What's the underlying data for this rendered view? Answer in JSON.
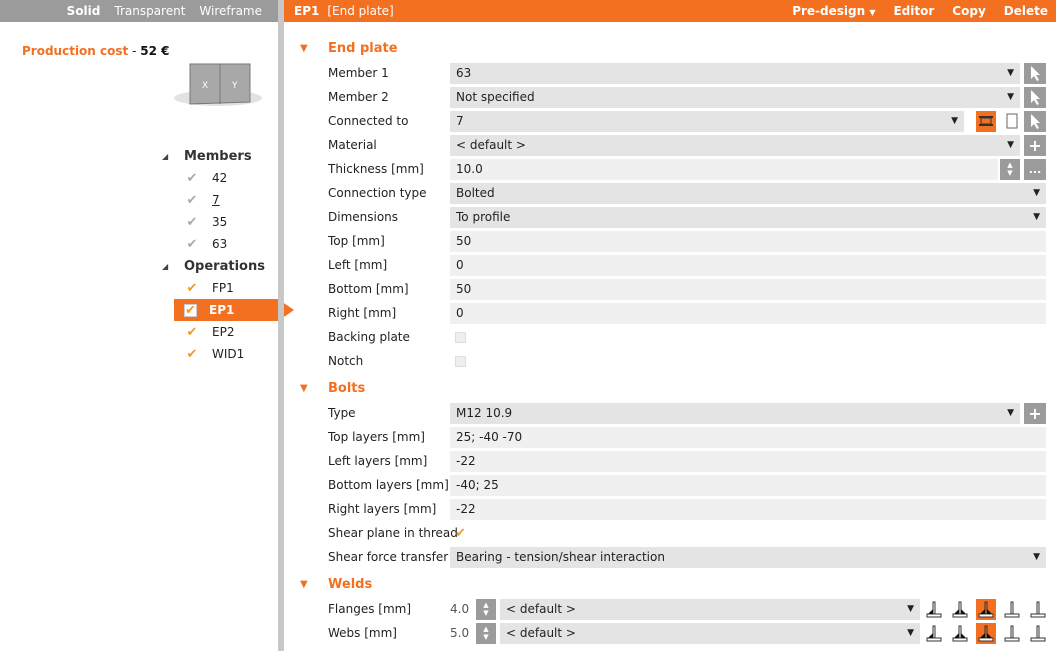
{
  "left": {
    "view_modes": [
      "Solid",
      "Transparent",
      "Wireframe"
    ],
    "active_mode": "Solid",
    "cost_label": "Production cost",
    "cost_sep": "-",
    "cost_value": "52 €",
    "members_label": "Members",
    "members": [
      "42",
      "7",
      "35",
      "63"
    ],
    "operations_label": "Operations",
    "operations": [
      "FP1",
      "EP1",
      "EP2",
      "WID1"
    ],
    "selected_operation": "EP1"
  },
  "header": {
    "id": "EP1",
    "name": "[End plate]",
    "predesign": "Pre-design",
    "editor": "Editor",
    "copy": "Copy",
    "delete": "Delete"
  },
  "sections": [
    {
      "title": "End plate",
      "rows": [
        {
          "label": "Member 1",
          "value": "63",
          "kind": "dd",
          "btn": "pick"
        },
        {
          "label": "Member 2",
          "value": "Not specified",
          "kind": "dd",
          "btn": "pick"
        },
        {
          "label": "Connected to",
          "value": "7",
          "kind": "dd-short",
          "btn": "pick"
        },
        {
          "label": "Material",
          "value": "< default >",
          "kind": "dd",
          "btn": "plus"
        },
        {
          "label": "Thickness [mm]",
          "value": "10.0",
          "kind": "tx-spin",
          "btn": "more",
          "more": "..."
        },
        {
          "label": "Connection type",
          "value": "Bolted",
          "kind": "ddfull"
        },
        {
          "label": "Dimensions",
          "value": "To profile",
          "kind": "ddfull"
        },
        {
          "label": "Top [mm]",
          "value": "50",
          "kind": "tx"
        },
        {
          "label": "Left [mm]",
          "value": "0",
          "kind": "tx"
        },
        {
          "label": "Bottom [mm]",
          "value": "50",
          "kind": "tx"
        },
        {
          "label": "Right [mm]",
          "value": "0",
          "kind": "tx"
        },
        {
          "label": "Backing plate",
          "kind": "cb",
          "checked": false
        },
        {
          "label": "Notch",
          "kind": "cb",
          "checked": false
        }
      ]
    },
    {
      "title": "Bolts",
      "rows": [
        {
          "label": "Type",
          "value": "M12 10.9",
          "kind": "dd",
          "btn": "plus"
        },
        {
          "label": "Top layers [mm]",
          "value": "25; -40 -70",
          "kind": "tx"
        },
        {
          "label": "Left layers [mm]",
          "value": "-22",
          "kind": "tx"
        },
        {
          "label": "Bottom layers [mm]",
          "value": "-40; 25",
          "kind": "tx"
        },
        {
          "label": "Right layers [mm]",
          "value": "-22",
          "kind": "tx"
        },
        {
          "label": "Shear plane in thread",
          "kind": "cb",
          "checked": true
        },
        {
          "label": "Shear force transfer",
          "value": "Bearing - tension/shear interaction",
          "kind": "ddfull"
        }
      ]
    },
    {
      "title": "Welds",
      "rows": [
        {
          "label": "Flanges [mm]",
          "size": "4.0",
          "value": "< default >",
          "kind": "weld",
          "active_type": 2
        },
        {
          "label": "Webs [mm]",
          "size": "5.0",
          "value": "< default >",
          "kind": "weld",
          "active_type": 2
        }
      ]
    }
  ],
  "colors": {
    "accent": "#f37021",
    "grey": "#9b9b9b"
  }
}
